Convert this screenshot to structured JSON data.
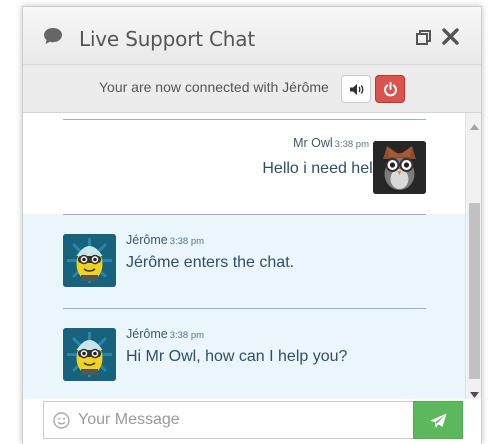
{
  "header": {
    "title": "Live Support Chat",
    "chat_icon": "comment-icon",
    "restore_icon": "restore-window-icon",
    "close_icon": "close-icon"
  },
  "status": {
    "text": "Your are now connected with Jérôme",
    "sound_icon": "volume-icon",
    "power_icon": "power-icon",
    "power_color": "#d9534f"
  },
  "messages": [
    {
      "sender": "Mr Owl",
      "time": "3:38 pm",
      "text": "Hello i need help!",
      "role": "user",
      "avatar": "owl-avatar"
    },
    {
      "sender": "Jérôme",
      "time": "3:38 pm",
      "text": "Jérôme enters the chat.",
      "role": "agent",
      "avatar": "agent-avatar"
    },
    {
      "sender": "Jérôme",
      "time": "3:38 pm",
      "text": "Hi Mr Owl, how can I help you?",
      "role": "agent",
      "avatar": "agent-avatar"
    }
  ],
  "composer": {
    "placeholder": "Your Message",
    "emoji_icon": "smiley-icon",
    "send_icon": "paper-plane-icon",
    "send_color": "#5cb85c"
  }
}
